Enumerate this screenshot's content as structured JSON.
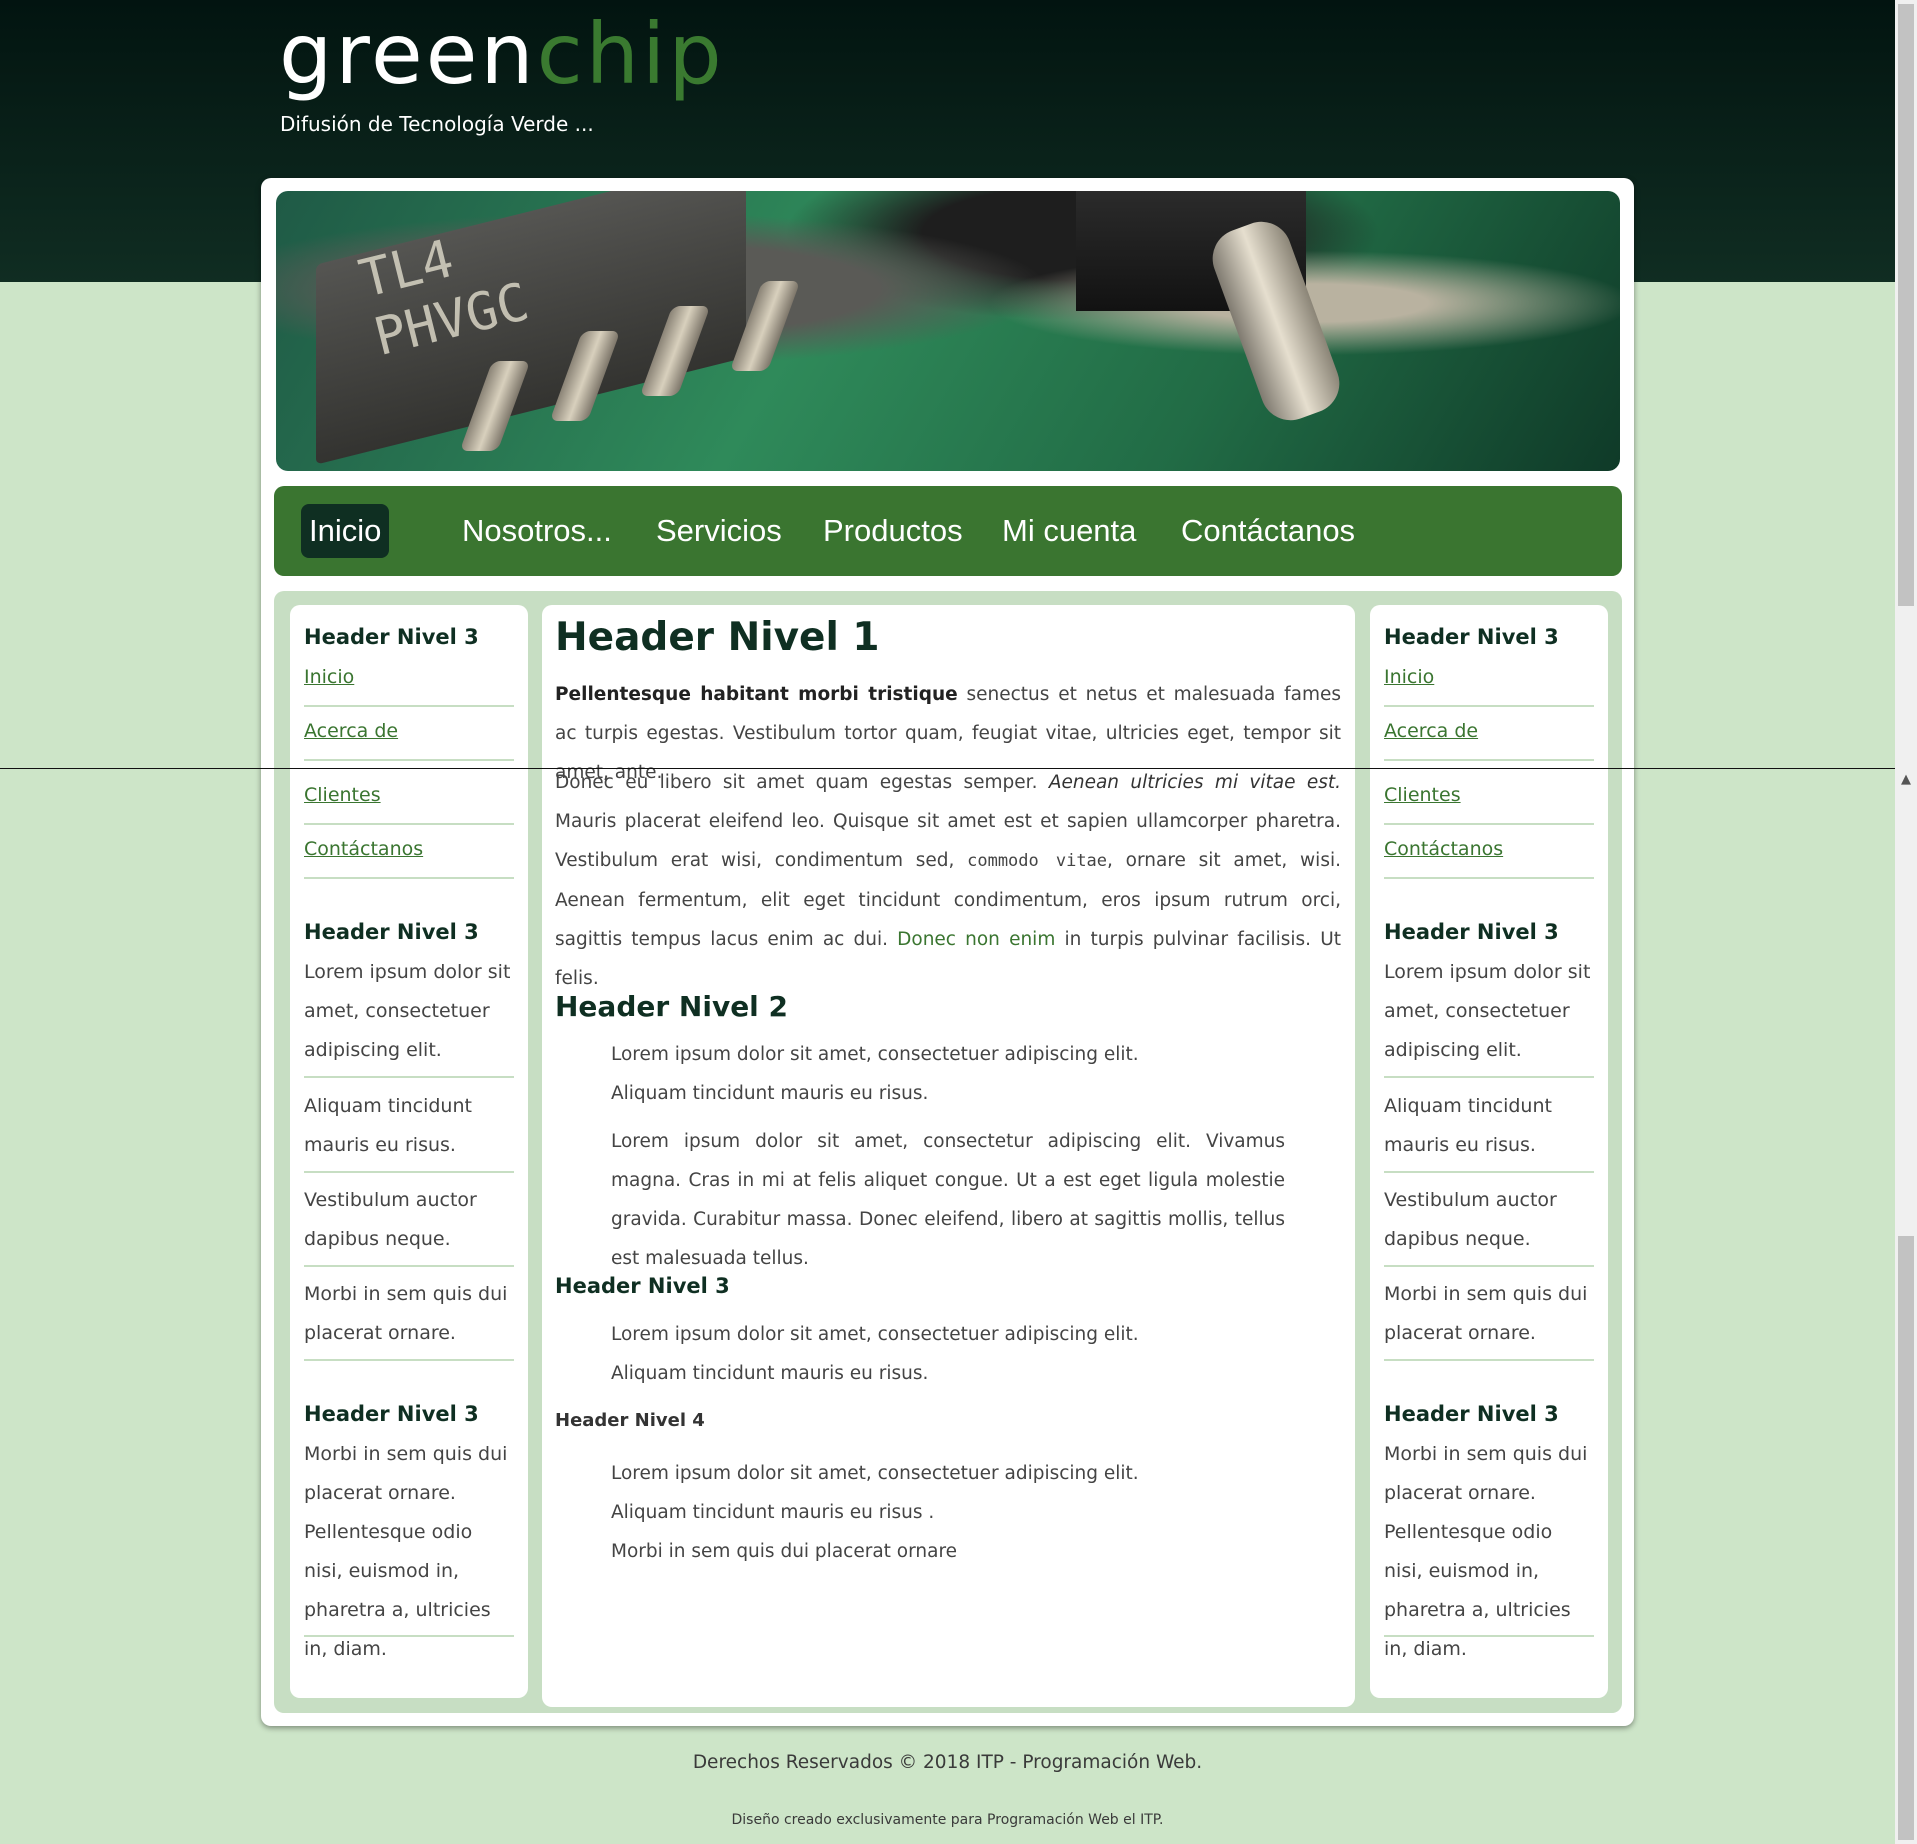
{
  "header": {
    "logo_white": "green",
    "logo_green": "chip",
    "tagline": "Difusión de Tecnología Verde ..."
  },
  "hero": {
    "chip_marking": "TL4\nPHVGC"
  },
  "nav": {
    "items": [
      {
        "label": "Inicio",
        "active": true
      },
      {
        "label": "Nosotros..."
      },
      {
        "label": "Servicios"
      },
      {
        "label": "Productos"
      },
      {
        "label": "Mi cuenta"
      },
      {
        "label": "Contáctanos"
      }
    ]
  },
  "sidebar": {
    "block1": {
      "title": "Header Nivel 3",
      "links": [
        "Inicio",
        "Acerca de",
        "Clientes",
        "Contáctanos"
      ]
    },
    "block2": {
      "title": "Header Nivel 3",
      "items": [
        "Lorem ipsum dolor sit amet, consectetuer adipiscing elit.",
        "Aliquam tincidunt mauris eu risus.",
        "Vestibulum auctor dapibus neque.",
        "Morbi in sem quis dui placerat ornare."
      ]
    },
    "block3": {
      "title": "Header Nivel 3",
      "text": "Morbi in sem quis dui placerat ornare. Pellentesque odio nisi, euismod in, pharetra a, ultricies in, diam."
    }
  },
  "main": {
    "h1": "Header Nivel 1",
    "p1_bold": "Pellentesque habitant morbi tristique",
    "p1_text": " senectus et netus et malesuada fames ac turpis egestas. Vestibulum tortor quam, feugiat vitae, ultricies eget, tempor sit amet, ante.",
    "p2_start": "Donec eu libero sit amet quam egestas semper. ",
    "p2_em": "Aenean ultricies mi vitae est.",
    "p2_mid": " Mauris placerat eleifend leo. Quisque sit amet est et sapien ullamcorper pharetra. Vestibulum erat wisi, condimentum sed, ",
    "p2_code": "commodo vitae",
    "p2_mid2": ", ornare sit amet, wisi. Aenean fermentum, elit eget tincidunt condimentum, eros ipsum rutrum orci, sagittis tempus lacus enim ac dui. ",
    "p2_link": "Donec non enim",
    "p2_end": " in turpis pulvinar facilisis. Ut felis.",
    "h2": "Header Nivel 2",
    "list1": [
      "Lorem ipsum dolor sit amet, consectetuer adipiscing elit.",
      "Aliquam tincidunt mauris eu risus."
    ],
    "quote": "Lorem ipsum dolor sit amet, consectetur adipiscing elit. Vivamus magna. Cras in mi at felis aliquet congue. Ut a est eget ligula molestie gravida. Curabitur massa. Donec eleifend, libero at sagittis mollis, tellus est malesuada tellus.",
    "h3": "Header Nivel 3",
    "list2": [
      "Lorem ipsum dolor sit amet, consectetuer adipiscing elit.",
      "Aliquam tincidunt mauris eu risus."
    ],
    "h4": "Header Nivel 4",
    "list3": [
      "Lorem ipsum dolor sit amet, consectetuer adipiscing elit.",
      "Aliquam tincidunt mauris eu risus .",
      "Morbi in sem quis dui placerat ornare"
    ]
  },
  "footer": {
    "line1": "Derechos Reservados © 2018 ITP - Programación Web.",
    "line2": "Diseño creado exclusivamente para Programación Web el ITP."
  },
  "colors": {
    "header_bg": "#021410",
    "page_bg": "#cde5c8",
    "accent_green": "#3a7530",
    "nav_active": "#0f2f22"
  },
  "icons": {
    "scroll_up": "chevron-up-icon"
  }
}
